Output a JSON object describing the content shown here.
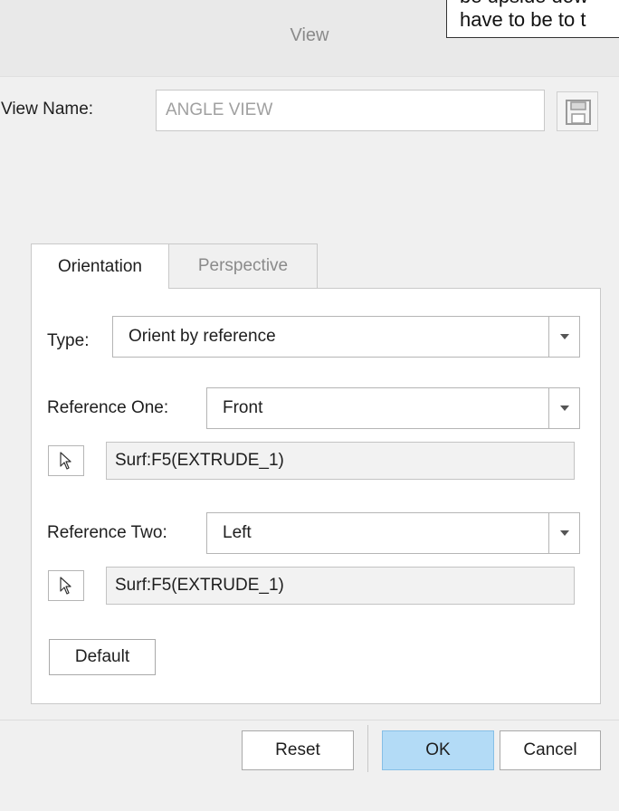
{
  "window": {
    "title": "View"
  },
  "overlay_note": {
    "line1": "be upside dow",
    "line2": "have to be to t"
  },
  "view_name": {
    "label": "View Name:",
    "value": "ANGLE VIEW",
    "save_icon": "floppy-disk-icon"
  },
  "tabs": [
    {
      "label": "Orientation",
      "active": true
    },
    {
      "label": "Perspective",
      "active": false
    }
  ],
  "orientation": {
    "type_label": "Type:",
    "type_value": "Orient by reference",
    "ref_one_label": "Reference One:",
    "ref_one_value": "Front",
    "ref_one_selection": "Surf:F5(EXTRUDE_1)",
    "ref_two_label": "Reference Two:",
    "ref_two_value": "Left",
    "ref_two_selection": "Surf:F5(EXTRUDE_1)",
    "default_button": "Default",
    "dropdown_icon": "chevron-down-icon",
    "pick_icon": "cursor-arrow-icon"
  },
  "footer": {
    "reset_button": "Reset",
    "ok_button": "OK",
    "cancel_button": "Cancel"
  },
  "colors": {
    "ok_button_bg": "#b3dbf6",
    "dialog_bg": "#f0f0f0"
  }
}
